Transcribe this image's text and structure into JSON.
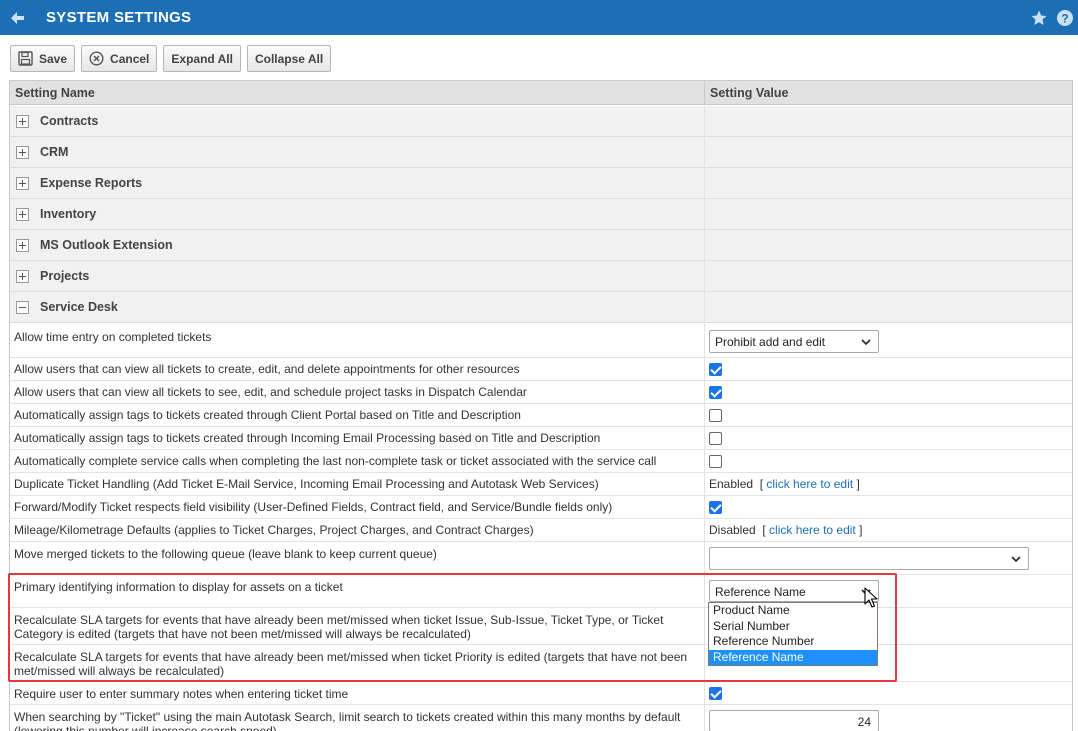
{
  "header": {
    "title": "SYSTEM SETTINGS"
  },
  "toolbar": {
    "save": "Save",
    "cancel": "Cancel",
    "expand_all": "Expand All",
    "collapse_all": "Collapse All"
  },
  "grid": {
    "col_name": "Setting Name",
    "col_value": "Setting Value"
  },
  "categories": [
    {
      "label": "Contracts",
      "expanded": false
    },
    {
      "label": "CRM",
      "expanded": false
    },
    {
      "label": "Expense Reports",
      "expanded": false
    },
    {
      "label": "Inventory",
      "expanded": false
    },
    {
      "label": "MS Outlook Extension",
      "expanded": false
    },
    {
      "label": "Projects",
      "expanded": false
    },
    {
      "label": "Service Desk",
      "expanded": true
    }
  ],
  "settings": [
    {
      "name": "Allow time entry on completed tickets",
      "type": "select",
      "value": "Prohibit add and edit"
    },
    {
      "name": "Allow users that can view all tickets to create, edit, and delete appointments for other resources",
      "type": "checkbox",
      "checked": true
    },
    {
      "name": "Allow users that can view all tickets to see, edit, and schedule project tasks in Dispatch Calendar",
      "type": "checkbox",
      "checked": true
    },
    {
      "name": "Automatically assign tags to tickets created through Client Portal based on Title and Description",
      "type": "checkbox",
      "checked": false
    },
    {
      "name": "Automatically assign tags to tickets created through Incoming Email Processing based on Title and Description",
      "type": "checkbox",
      "checked": false
    },
    {
      "name": "Automatically complete service calls when completing the last non-complete task or ticket associated with the service call",
      "type": "checkbox",
      "checked": false
    },
    {
      "name": "Duplicate Ticket Handling (Add Ticket E-Mail Service, Incoming Email Processing and Autotask Web Services)",
      "type": "status",
      "status": "Enabled",
      "link": "click here to edit"
    },
    {
      "name": "Forward/Modify Ticket respects field visibility (User-Defined Fields, Contract field, and Service/Bundle fields only)",
      "type": "checkbox",
      "checked": true
    },
    {
      "name": "Mileage/Kilometrage Defaults (applies to Ticket Charges, Project Charges, and Contract Charges)",
      "type": "status",
      "status": "Disabled",
      "link": "click here to edit"
    },
    {
      "name": "Move merged tickets to the following queue (leave blank to keep current queue)",
      "type": "select",
      "value": ""
    },
    {
      "name": "Primary identifying information to display for assets on a ticket",
      "type": "select",
      "value": "Reference Name"
    },
    {
      "name": "Recalculate SLA targets for events that have already been met/missed when ticket Issue, Sub-Issue, Ticket Type, or Ticket Category is edited (targets that have not been met/missed will always be recalculated)",
      "type": "hidden"
    },
    {
      "name": "Recalculate SLA targets for events that have already been met/missed when ticket Priority is edited (targets that have not been met/missed will always be recalculated)",
      "type": "hidden"
    },
    {
      "name": "Require user to enter summary notes when entering ticket time",
      "type": "checkbox",
      "checked": true
    },
    {
      "name": "When searching by \"Ticket\" using the main Autotask Search, limit search to tickets created within this many months by default (lowering this number will increase search speed)",
      "type": "number",
      "value": "24"
    }
  ],
  "dropdown": {
    "options": [
      "Product Name",
      "Serial Number",
      "Reference Number",
      "Reference Name"
    ],
    "selected": "Reference Name"
  },
  "colors": {
    "header_bg": "#1c6fb5",
    "highlight": "#e0393e",
    "checkbox_on": "#1a73e8",
    "option_selected": "#1e90ff"
  }
}
